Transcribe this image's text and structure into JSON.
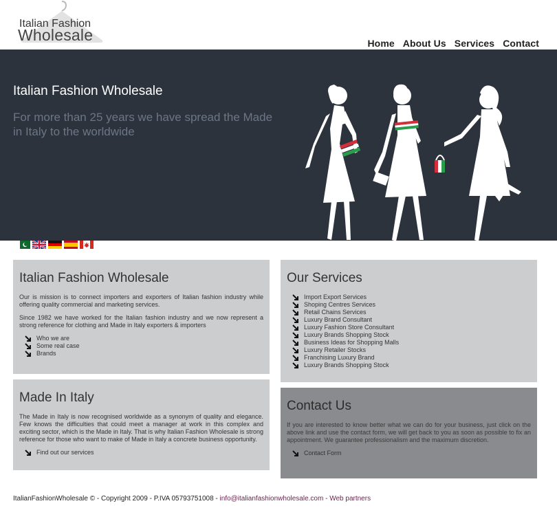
{
  "logo": {
    "line1": "Italian Fashion",
    "line2": "Wholesale"
  },
  "nav": {
    "items": [
      "Home",
      "About Us",
      "Services",
      "Contact"
    ]
  },
  "hero": {
    "title": "Italian Fashion Wholesale",
    "subtitle": "For more than 25 years we have spread the Made in Italy to the worldwide",
    "colors": {
      "background": "#2c333d",
      "subtitle": "#6c7684"
    }
  },
  "flags": [
    "pakistan-flag-icon",
    "uk-flag-icon",
    "germany-flag-icon",
    "spain-flag-icon",
    "canada-flag-icon"
  ],
  "box_ifw": {
    "title": "Italian Fashion Wholesale",
    "p1": "Our is mission is to connect importers and exporters of Italian fashion industry while offering quality commercial and marketing services.",
    "p2": "Since 1982 we have worked for the Italian fashion industry and we now represent a strong reference for clothing and Made in Italy exporters & importers",
    "links": [
      "Who we are",
      "Some real case",
      "Brands"
    ]
  },
  "box_services": {
    "title": "Our Services",
    "links": [
      "Import Export Services",
      "Shoping Centres Services",
      "Retail Chains Services",
      "Luxury Brand Consultant",
      "Luxury Fashion Store Consultant",
      "Luxury Brands Shopping Stock",
      "Business Ideas for Shopping Malls",
      "Luxury Retailer Stocks",
      "Franchising Luxury Brand",
      "Luxury Brands Shopping Stock"
    ]
  },
  "box_italy": {
    "title": "Made In Italy",
    "p1": "The Made in Italy is now recognised worldwide as a synonym of quality and elegance. Few knows the difficulties that could meet a manager at work in this complex and exciting sector, which is the Made in Italy. That is why Italian Fashion Wholesale is strong reference for those who want to make of Made in Italy a concrete business opportunity.",
    "links": [
      "Find out our services"
    ]
  },
  "box_contact": {
    "title": "Contact Us",
    "p1": "If you are interested to know better what we can do for your business, just click on the above link and use the contact form, we will get back to you as soon as possible to fix an appointment. We guarantee professionalism and the maximum discretion.",
    "links": [
      "Contact Form"
    ]
  },
  "footer": {
    "text": "ItalianFashionWholesale © - Copyright 2009 - P.IVA 05793751008 - ",
    "email": "info@italianfashionwholesale.com",
    "sep": " - ",
    "partners": "Web partners",
    "link_color": "#6b1f4c"
  },
  "colors": {
    "box": "#cccdcf",
    "box_dark": "#898b8e"
  }
}
